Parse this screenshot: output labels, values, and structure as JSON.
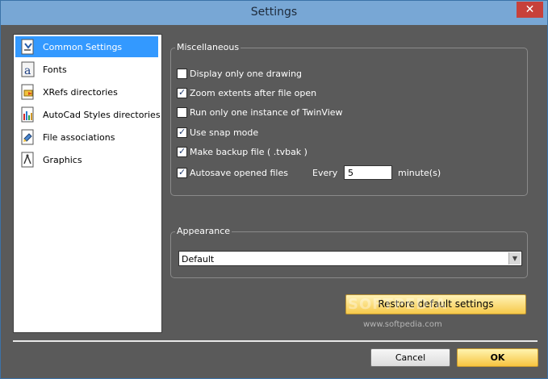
{
  "window": {
    "title": "Settings",
    "close_label": "✕"
  },
  "sidebar": {
    "items": [
      {
        "label": "Common Settings",
        "icon": "settings-page-icon",
        "selected": true
      },
      {
        "label": "Fonts",
        "icon": "font-icon",
        "selected": false
      },
      {
        "label": "XRefs directories",
        "icon": "xref-folder-icon",
        "selected": false
      },
      {
        "label": "AutoCad Styles directories",
        "icon": "styles-folder-icon",
        "selected": false
      },
      {
        "label": "File associations",
        "icon": "file-association-icon",
        "selected": false
      },
      {
        "label": "Graphics",
        "icon": "graphics-icon",
        "selected": false
      }
    ]
  },
  "miscellaneous": {
    "title": "Miscellaneous",
    "options": [
      {
        "label": "Display only one drawing",
        "checked": false
      },
      {
        "label": "Zoom extents after file open",
        "checked": true
      },
      {
        "label": "Run only one instance of TwinView",
        "checked": false
      },
      {
        "label": "Use snap mode",
        "checked": true
      },
      {
        "label": "Make backup file ( .tvbak )",
        "checked": true
      },
      {
        "label": "Autosave opened files",
        "checked": true
      }
    ],
    "every_label": "Every",
    "minutes_value": "5",
    "minutes_unit": "minute(s)"
  },
  "appearance": {
    "title": "Appearance",
    "selected": "Default"
  },
  "buttons": {
    "restore": "Restore default settings",
    "cancel": "Cancel",
    "ok": "OK"
  },
  "watermark": {
    "big": "SOFTPEDIA",
    "small": "www.softpedia.com"
  },
  "colors": {
    "window_bg": "#5a5a5a",
    "titlebar": "#78a7d5",
    "selection": "#3399ff",
    "close": "#c7413b",
    "button_gold": "#f7c440"
  }
}
